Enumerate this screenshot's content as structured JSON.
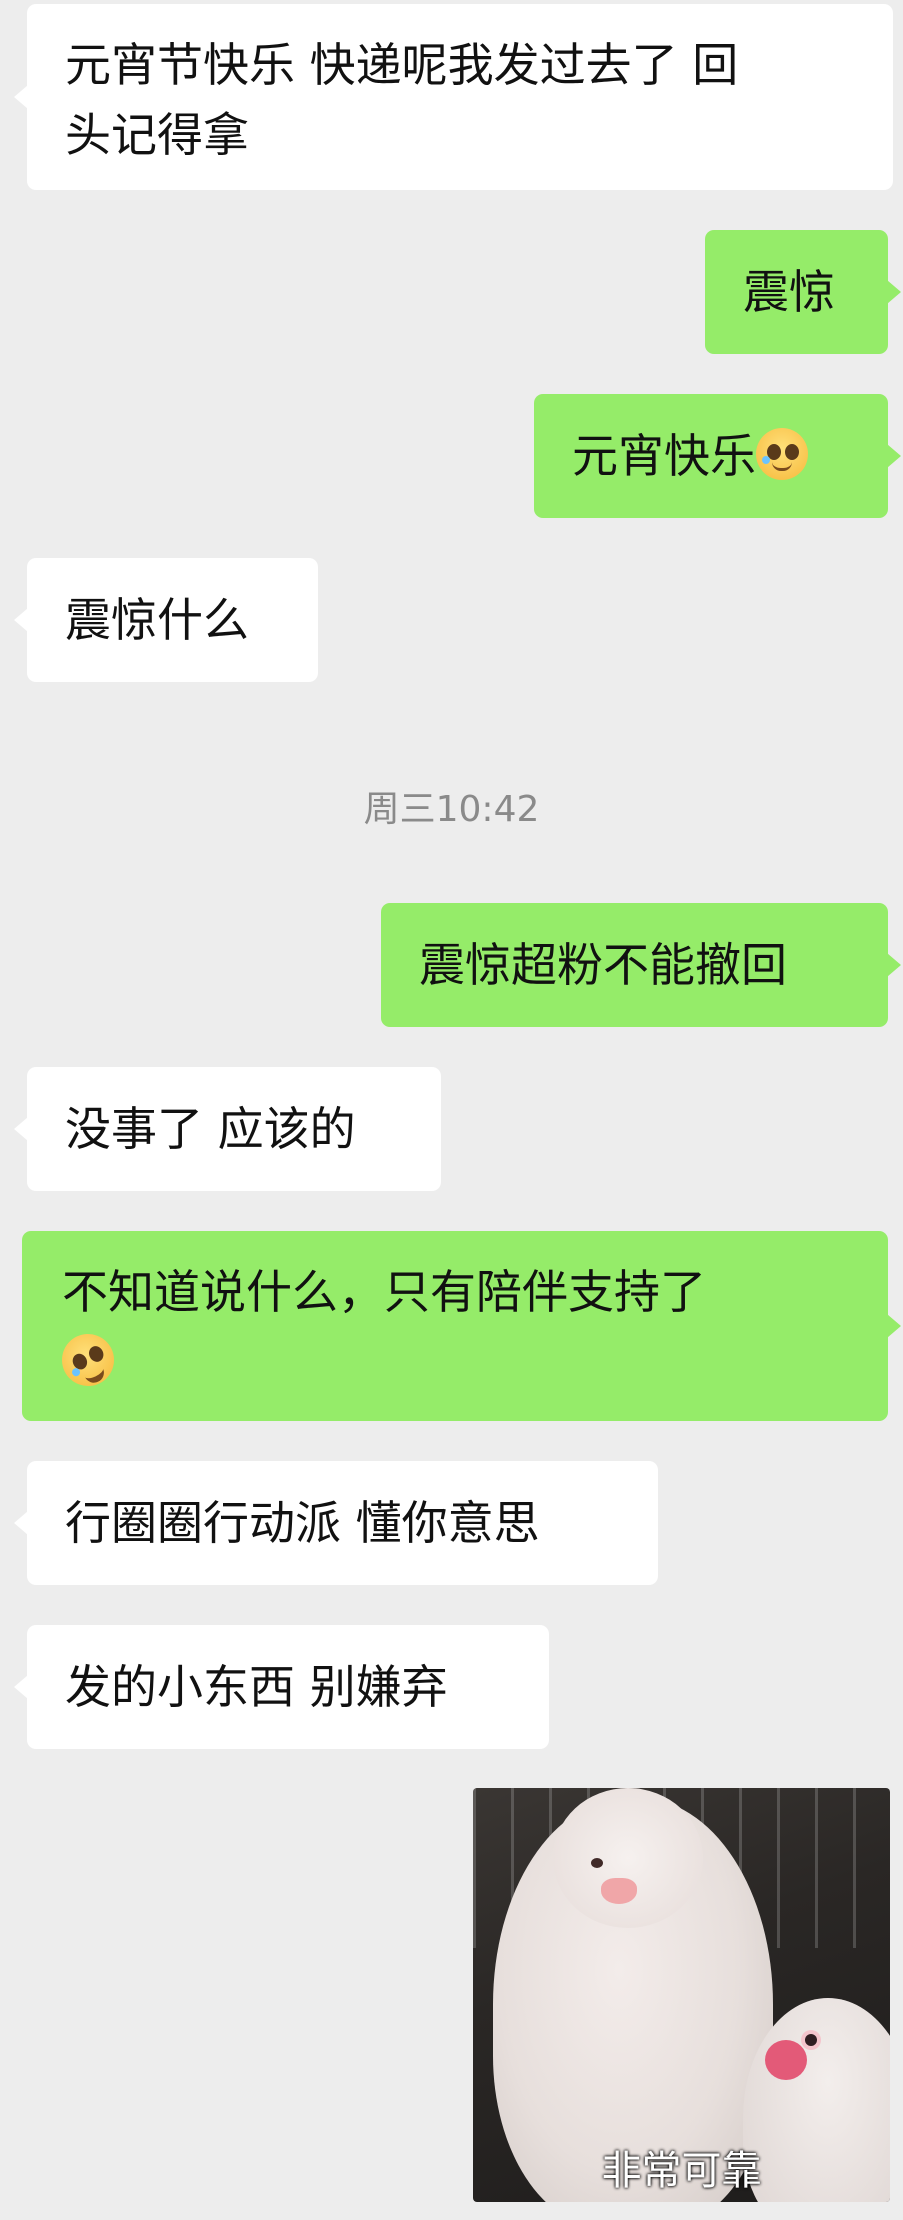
{
  "messages": [
    {
      "side": "in",
      "text": "元宵节快乐 快递呢我发过去了 回\n头记得拿"
    },
    {
      "side": "out",
      "text": "震惊"
    },
    {
      "side": "out",
      "text": "元宵快乐",
      "emoji": "pleading-face-emoji"
    },
    {
      "side": "in",
      "text": "震惊什么"
    },
    {
      "side": "out",
      "text": "震惊超粉不能撤回"
    },
    {
      "side": "in",
      "text": "没事了 应该的"
    },
    {
      "side": "out",
      "text": "不知道说什么，只有陪伴支持了\n",
      "emoji": "rolling-on-floor-laughing-emoji"
    },
    {
      "side": "in",
      "text": "行圈圈行动派 懂你意思"
    },
    {
      "side": "in",
      "text": "发的小东西 别嫌弃"
    }
  ],
  "timestamp": "周三10:42",
  "sticker": {
    "caption": "非常可靠",
    "image": "two-white-doves-photo"
  },
  "colors": {
    "background": "#ededed",
    "incoming": "#ffffff",
    "outgoing": "#95ec69"
  }
}
